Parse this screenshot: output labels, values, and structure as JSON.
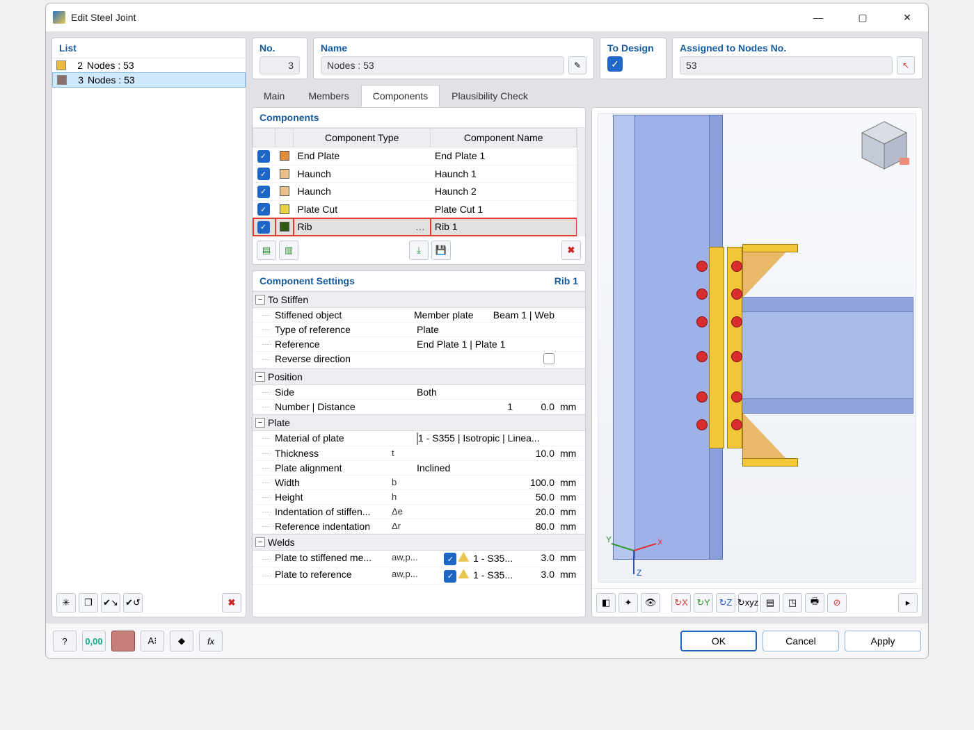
{
  "window": {
    "title": "Edit Steel Joint"
  },
  "listPanel": {
    "header": "List",
    "items": [
      {
        "idx": "2",
        "label": "Nodes : 53",
        "color": "#e8b93b",
        "selected": false
      },
      {
        "idx": "3",
        "label": "Nodes : 53",
        "color": "#8a6f6f",
        "selected": true
      }
    ]
  },
  "topFields": {
    "no_label": "No.",
    "no_value": "3",
    "name_label": "Name",
    "name_value": "Nodes : 53",
    "design_label": "To Design",
    "assigned_label": "Assigned to Nodes No.",
    "assigned_value": "53"
  },
  "tabs": [
    "Main",
    "Members",
    "Components",
    "Plausibility Check"
  ],
  "activeTab": 2,
  "componentsPanel": {
    "header": "Components",
    "col_type": "Component Type",
    "col_name": "Component Name",
    "rows": [
      {
        "color": "#e08c3a",
        "type": "End Plate",
        "name": "End Plate 1",
        "hl": false
      },
      {
        "color": "#e8c088",
        "type": "Haunch",
        "name": "Haunch 1",
        "hl": false
      },
      {
        "color": "#e8c088",
        "type": "Haunch",
        "name": "Haunch 2",
        "hl": false
      },
      {
        "color": "#e8d142",
        "type": "Plate Cut",
        "name": "Plate Cut 1",
        "hl": false
      },
      {
        "color": "#2f5c12",
        "type": "Rib",
        "name": "Rib 1",
        "hl": true
      }
    ]
  },
  "settings": {
    "header_left": "Component Settings",
    "header_right": "Rib 1",
    "groups": [
      {
        "title": "To Stiffen",
        "rows": [
          {
            "label": "Stiffened object",
            "sym": "",
            "val": "Member plate",
            "extra": "Beam 1 | Web",
            "unit": ""
          },
          {
            "label": "Type of reference",
            "sym": "",
            "val": "Plate",
            "unit": "",
            "left": true
          },
          {
            "label": "Reference",
            "sym": "",
            "val": "End Plate 1 | Plate 1",
            "unit": "",
            "left": true
          },
          {
            "label": "Reverse direction",
            "sym": "",
            "val": "__chk__",
            "unit": ""
          }
        ]
      },
      {
        "title": "Position",
        "rows": [
          {
            "label": "Side",
            "sym": "",
            "val": "Both",
            "unit": "",
            "left": true
          },
          {
            "label": "Number | Distance",
            "sym": "",
            "val": "1",
            "extraR": "0.0",
            "unit": "mm"
          }
        ]
      },
      {
        "title": "Plate",
        "rows": [
          {
            "label": "Material of plate",
            "sym": "",
            "val": "1 - S355 | Isotropic | Linea...",
            "unit": "",
            "swatch": "#b9f0ee",
            "left": true
          },
          {
            "label": "Thickness",
            "sym": "t",
            "val": "10.0",
            "unit": "mm"
          },
          {
            "label": "Plate alignment",
            "sym": "",
            "val": "Inclined",
            "unit": "",
            "left": true
          },
          {
            "label": "Width",
            "sym": "b",
            "val": "100.0",
            "unit": "mm"
          },
          {
            "label": "Height",
            "sym": "h",
            "val": "50.0",
            "unit": "mm"
          },
          {
            "label": "Indentation of stiffen...",
            "sym": "Δe",
            "val": "20.0",
            "unit": "mm"
          },
          {
            "label": "Reference indentation",
            "sym": "Δr",
            "val": "80.0",
            "unit": "mm"
          }
        ]
      },
      {
        "title": "Welds",
        "rows": [
          {
            "label": "Plate to stiffened me...",
            "sym": "aw,p...",
            "val": "1 - S35...",
            "extraR": "3.0",
            "unit": "mm",
            "weld": true
          },
          {
            "label": "Plate to reference",
            "sym": "aw,p...",
            "val": "1 - S35...",
            "extraR": "3.0",
            "unit": "mm",
            "weld": true
          }
        ]
      }
    ]
  },
  "footer": {
    "ok": "OK",
    "cancel": "Cancel",
    "apply": "Apply"
  }
}
